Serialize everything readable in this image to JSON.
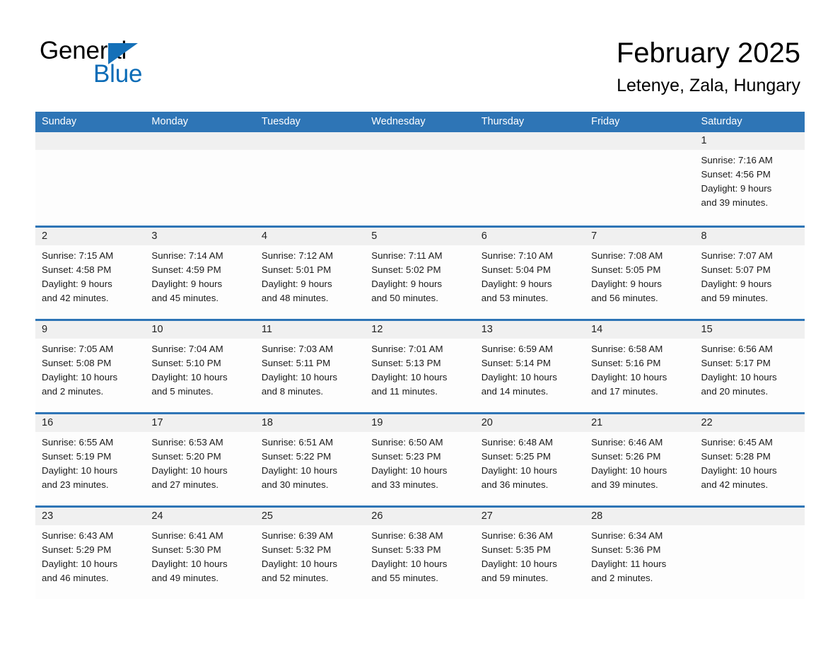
{
  "brand": {
    "name_part1": "General",
    "name_part2": "Blue",
    "accent_color": "#1570b8",
    "blue_text_color": "#0b6cb7"
  },
  "header": {
    "title": "February 2025",
    "location": "Letenye, Zala, Hungary"
  },
  "calendar": {
    "header_background": "#2e75b6",
    "header_text_color": "#ffffff",
    "daynum_band_color": "#f0f0f0",
    "weekdays": [
      "Sunday",
      "Monday",
      "Tuesday",
      "Wednesday",
      "Thursday",
      "Friday",
      "Saturday"
    ],
    "weeks": [
      [
        {
          "day": "",
          "sunrise": "",
          "sunset": "",
          "daylight_line1": "",
          "daylight_line2": ""
        },
        {
          "day": "",
          "sunrise": "",
          "sunset": "",
          "daylight_line1": "",
          "daylight_line2": ""
        },
        {
          "day": "",
          "sunrise": "",
          "sunset": "",
          "daylight_line1": "",
          "daylight_line2": ""
        },
        {
          "day": "",
          "sunrise": "",
          "sunset": "",
          "daylight_line1": "",
          "daylight_line2": ""
        },
        {
          "day": "",
          "sunrise": "",
          "sunset": "",
          "daylight_line1": "",
          "daylight_line2": ""
        },
        {
          "day": "",
          "sunrise": "",
          "sunset": "",
          "daylight_line1": "",
          "daylight_line2": ""
        },
        {
          "day": "1",
          "sunrise": "Sunrise: 7:16 AM",
          "sunset": "Sunset: 4:56 PM",
          "daylight_line1": "Daylight: 9 hours",
          "daylight_line2": "and 39 minutes."
        }
      ],
      [
        {
          "day": "2",
          "sunrise": "Sunrise: 7:15 AM",
          "sunset": "Sunset: 4:58 PM",
          "daylight_line1": "Daylight: 9 hours",
          "daylight_line2": "and 42 minutes."
        },
        {
          "day": "3",
          "sunrise": "Sunrise: 7:14 AM",
          "sunset": "Sunset: 4:59 PM",
          "daylight_line1": "Daylight: 9 hours",
          "daylight_line2": "and 45 minutes."
        },
        {
          "day": "4",
          "sunrise": "Sunrise: 7:12 AM",
          "sunset": "Sunset: 5:01 PM",
          "daylight_line1": "Daylight: 9 hours",
          "daylight_line2": "and 48 minutes."
        },
        {
          "day": "5",
          "sunrise": "Sunrise: 7:11 AM",
          "sunset": "Sunset: 5:02 PM",
          "daylight_line1": "Daylight: 9 hours",
          "daylight_line2": "and 50 minutes."
        },
        {
          "day": "6",
          "sunrise": "Sunrise: 7:10 AM",
          "sunset": "Sunset: 5:04 PM",
          "daylight_line1": "Daylight: 9 hours",
          "daylight_line2": "and 53 minutes."
        },
        {
          "day": "7",
          "sunrise": "Sunrise: 7:08 AM",
          "sunset": "Sunset: 5:05 PM",
          "daylight_line1": "Daylight: 9 hours",
          "daylight_line2": "and 56 minutes."
        },
        {
          "day": "8",
          "sunrise": "Sunrise: 7:07 AM",
          "sunset": "Sunset: 5:07 PM",
          "daylight_line1": "Daylight: 9 hours",
          "daylight_line2": "and 59 minutes."
        }
      ],
      [
        {
          "day": "9",
          "sunrise": "Sunrise: 7:05 AM",
          "sunset": "Sunset: 5:08 PM",
          "daylight_line1": "Daylight: 10 hours",
          "daylight_line2": "and 2 minutes."
        },
        {
          "day": "10",
          "sunrise": "Sunrise: 7:04 AM",
          "sunset": "Sunset: 5:10 PM",
          "daylight_line1": "Daylight: 10 hours",
          "daylight_line2": "and 5 minutes."
        },
        {
          "day": "11",
          "sunrise": "Sunrise: 7:03 AM",
          "sunset": "Sunset: 5:11 PM",
          "daylight_line1": "Daylight: 10 hours",
          "daylight_line2": "and 8 minutes."
        },
        {
          "day": "12",
          "sunrise": "Sunrise: 7:01 AM",
          "sunset": "Sunset: 5:13 PM",
          "daylight_line1": "Daylight: 10 hours",
          "daylight_line2": "and 11 minutes."
        },
        {
          "day": "13",
          "sunrise": "Sunrise: 6:59 AM",
          "sunset": "Sunset: 5:14 PM",
          "daylight_line1": "Daylight: 10 hours",
          "daylight_line2": "and 14 minutes."
        },
        {
          "day": "14",
          "sunrise": "Sunrise: 6:58 AM",
          "sunset": "Sunset: 5:16 PM",
          "daylight_line1": "Daylight: 10 hours",
          "daylight_line2": "and 17 minutes."
        },
        {
          "day": "15",
          "sunrise": "Sunrise: 6:56 AM",
          "sunset": "Sunset: 5:17 PM",
          "daylight_line1": "Daylight: 10 hours",
          "daylight_line2": "and 20 minutes."
        }
      ],
      [
        {
          "day": "16",
          "sunrise": "Sunrise: 6:55 AM",
          "sunset": "Sunset: 5:19 PM",
          "daylight_line1": "Daylight: 10 hours",
          "daylight_line2": "and 23 minutes."
        },
        {
          "day": "17",
          "sunrise": "Sunrise: 6:53 AM",
          "sunset": "Sunset: 5:20 PM",
          "daylight_line1": "Daylight: 10 hours",
          "daylight_line2": "and 27 minutes."
        },
        {
          "day": "18",
          "sunrise": "Sunrise: 6:51 AM",
          "sunset": "Sunset: 5:22 PM",
          "daylight_line1": "Daylight: 10 hours",
          "daylight_line2": "and 30 minutes."
        },
        {
          "day": "19",
          "sunrise": "Sunrise: 6:50 AM",
          "sunset": "Sunset: 5:23 PM",
          "daylight_line1": "Daylight: 10 hours",
          "daylight_line2": "and 33 minutes."
        },
        {
          "day": "20",
          "sunrise": "Sunrise: 6:48 AM",
          "sunset": "Sunset: 5:25 PM",
          "daylight_line1": "Daylight: 10 hours",
          "daylight_line2": "and 36 minutes."
        },
        {
          "day": "21",
          "sunrise": "Sunrise: 6:46 AM",
          "sunset": "Sunset: 5:26 PM",
          "daylight_line1": "Daylight: 10 hours",
          "daylight_line2": "and 39 minutes."
        },
        {
          "day": "22",
          "sunrise": "Sunrise: 6:45 AM",
          "sunset": "Sunset: 5:28 PM",
          "daylight_line1": "Daylight: 10 hours",
          "daylight_line2": "and 42 minutes."
        }
      ],
      [
        {
          "day": "23",
          "sunrise": "Sunrise: 6:43 AM",
          "sunset": "Sunset: 5:29 PM",
          "daylight_line1": "Daylight: 10 hours",
          "daylight_line2": "and 46 minutes."
        },
        {
          "day": "24",
          "sunrise": "Sunrise: 6:41 AM",
          "sunset": "Sunset: 5:30 PM",
          "daylight_line1": "Daylight: 10 hours",
          "daylight_line2": "and 49 minutes."
        },
        {
          "day": "25",
          "sunrise": "Sunrise: 6:39 AM",
          "sunset": "Sunset: 5:32 PM",
          "daylight_line1": "Daylight: 10 hours",
          "daylight_line2": "and 52 minutes."
        },
        {
          "day": "26",
          "sunrise": "Sunrise: 6:38 AM",
          "sunset": "Sunset: 5:33 PM",
          "daylight_line1": "Daylight: 10 hours",
          "daylight_line2": "and 55 minutes."
        },
        {
          "day": "27",
          "sunrise": "Sunrise: 6:36 AM",
          "sunset": "Sunset: 5:35 PM",
          "daylight_line1": "Daylight: 10 hours",
          "daylight_line2": "and 59 minutes."
        },
        {
          "day": "28",
          "sunrise": "Sunrise: 6:34 AM",
          "sunset": "Sunset: 5:36 PM",
          "daylight_line1": "Daylight: 11 hours",
          "daylight_line2": "and 2 minutes."
        },
        {
          "day": "",
          "sunrise": "",
          "sunset": "",
          "daylight_line1": "",
          "daylight_line2": ""
        }
      ]
    ]
  }
}
